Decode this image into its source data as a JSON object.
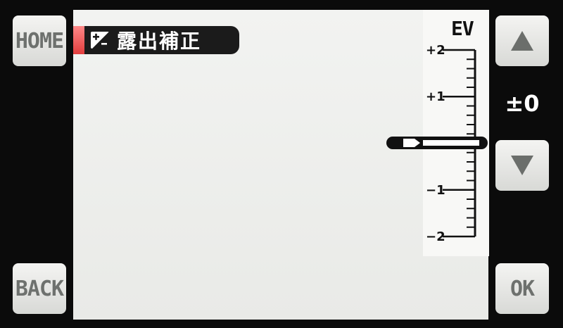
{
  "buttons": {
    "home": "HOME",
    "back": "BACK",
    "ok": "OK"
  },
  "title": {
    "text": "露出補正",
    "icon": "exposure-compensation-icon"
  },
  "scale": {
    "unit": "EV",
    "labels": [
      "+2",
      "+1",
      "−1",
      "−2"
    ],
    "min": -2,
    "max": 2,
    "current": 0
  },
  "value_display": "±0",
  "colors": {
    "accent_red": "#e23d3d",
    "background": "#0b0b0b"
  }
}
